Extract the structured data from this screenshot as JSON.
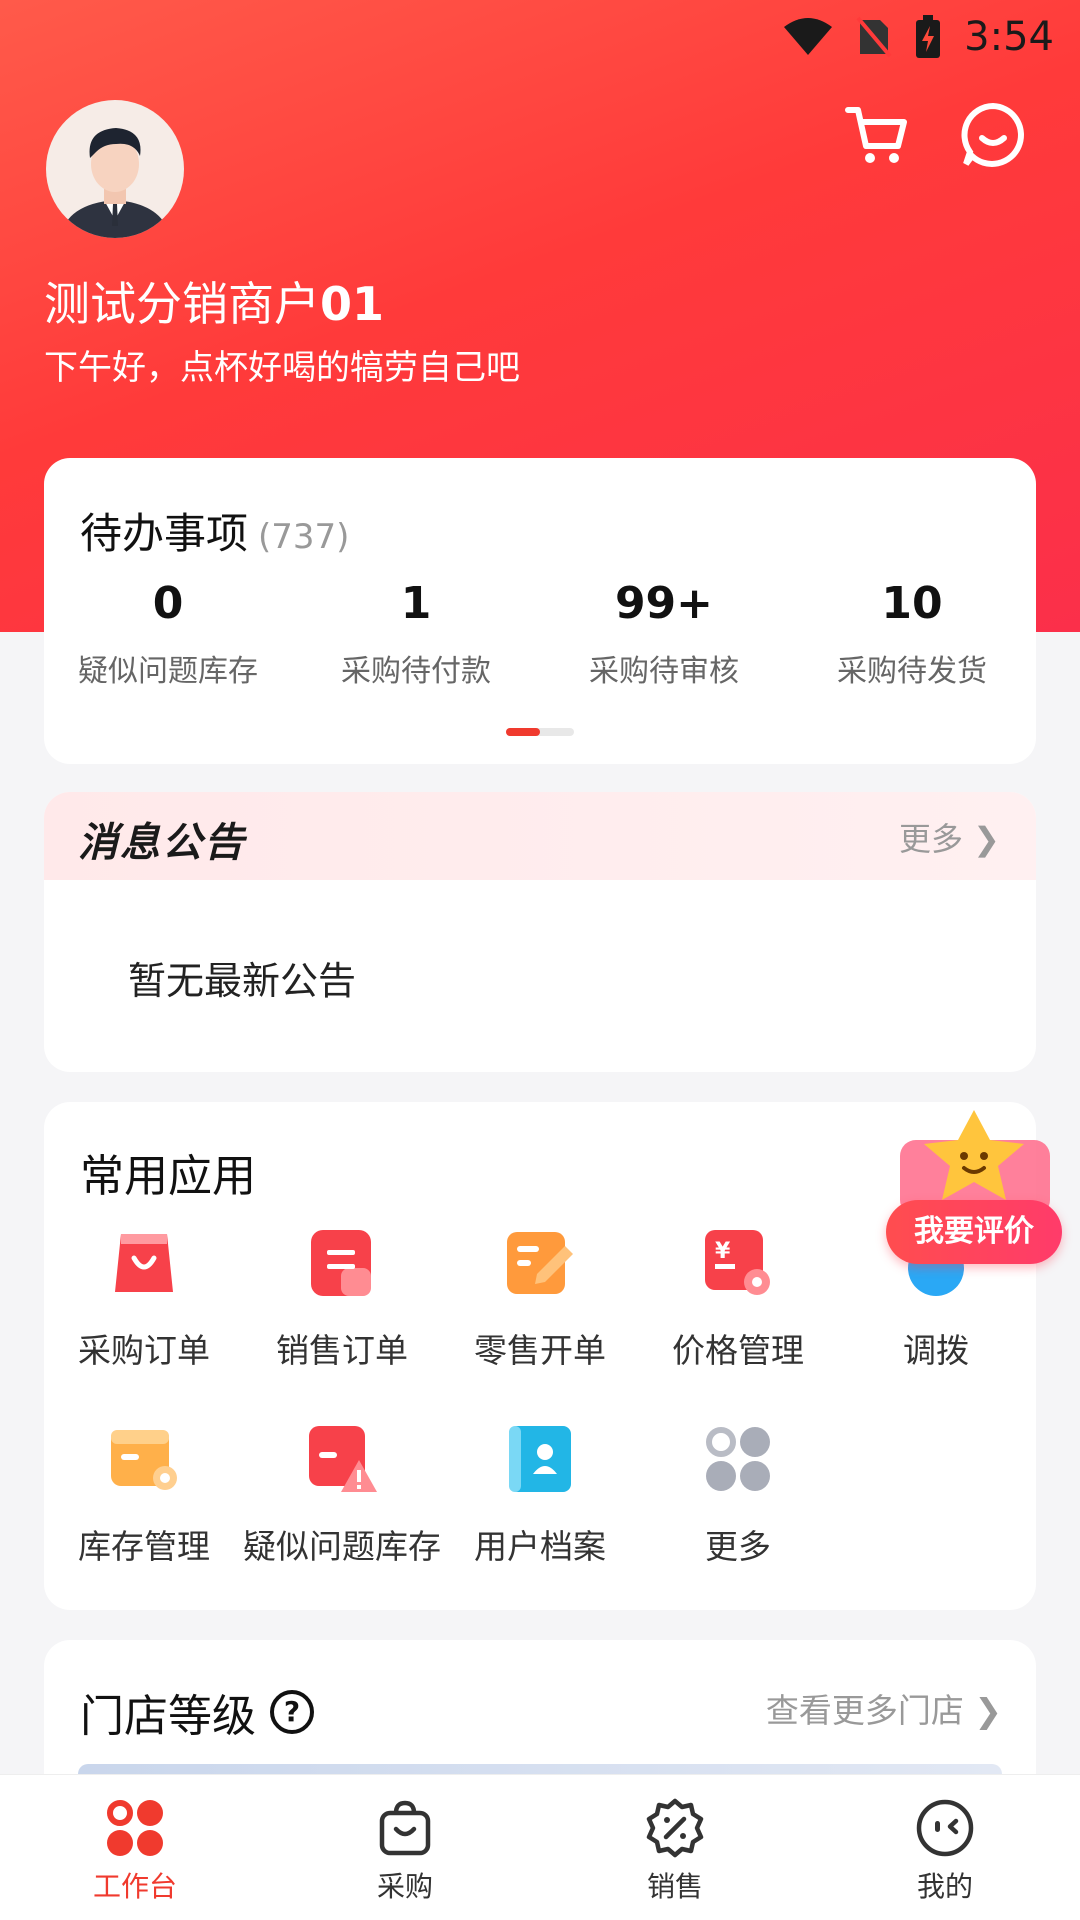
{
  "status_bar": {
    "time": "3:54"
  },
  "header": {
    "user_name_prefix": "测试分销商户",
    "user_name_suffix": "01",
    "greeting": "下午好，点杯好喝的犒劳自己吧"
  },
  "todo": {
    "title": "待办事项",
    "count": "(737)",
    "items": [
      {
        "value": "0",
        "label": "疑似问题库存"
      },
      {
        "value": "1",
        "label": "采购待付款"
      },
      {
        "value": "99+",
        "label": "采购待审核"
      },
      {
        "value": "10",
        "label": "采购待发货"
      }
    ]
  },
  "notice": {
    "title": "消息公告",
    "more": "更多 ❯",
    "empty": "暂无最新公告"
  },
  "apps": {
    "title": "常用应用",
    "items": [
      {
        "label": "采购订单",
        "icon": "shopping-bag-icon"
      },
      {
        "label": "销售订单",
        "icon": "order-doc-icon"
      },
      {
        "label": "零售开单",
        "icon": "edit-note-icon"
      },
      {
        "label": "价格管理",
        "icon": "price-tag-icon"
      },
      {
        "label": "调拨",
        "icon": "transfer-icon"
      },
      {
        "label": "库存管理",
        "icon": "inventory-icon"
      },
      {
        "label": "疑似问题库存",
        "icon": "warning-stock-icon"
      },
      {
        "label": "用户档案",
        "icon": "user-profile-icon"
      },
      {
        "label": "更多",
        "icon": "more-grid-icon"
      }
    ],
    "review_button": "我要评价"
  },
  "store": {
    "title": "门店等级",
    "more": "查看更多门店 ❯"
  },
  "tabbar": {
    "items": [
      {
        "label": "工作台",
        "icon": "workbench-icon",
        "active": true
      },
      {
        "label": "采购",
        "icon": "purchase-bag-icon",
        "active": false
      },
      {
        "label": "销售",
        "icon": "sales-discount-icon",
        "active": false
      },
      {
        "label": "我的",
        "icon": "profile-face-icon",
        "active": false
      }
    ]
  },
  "colors": {
    "primary": "#f03a2e",
    "hero": "#ff3a3a"
  }
}
